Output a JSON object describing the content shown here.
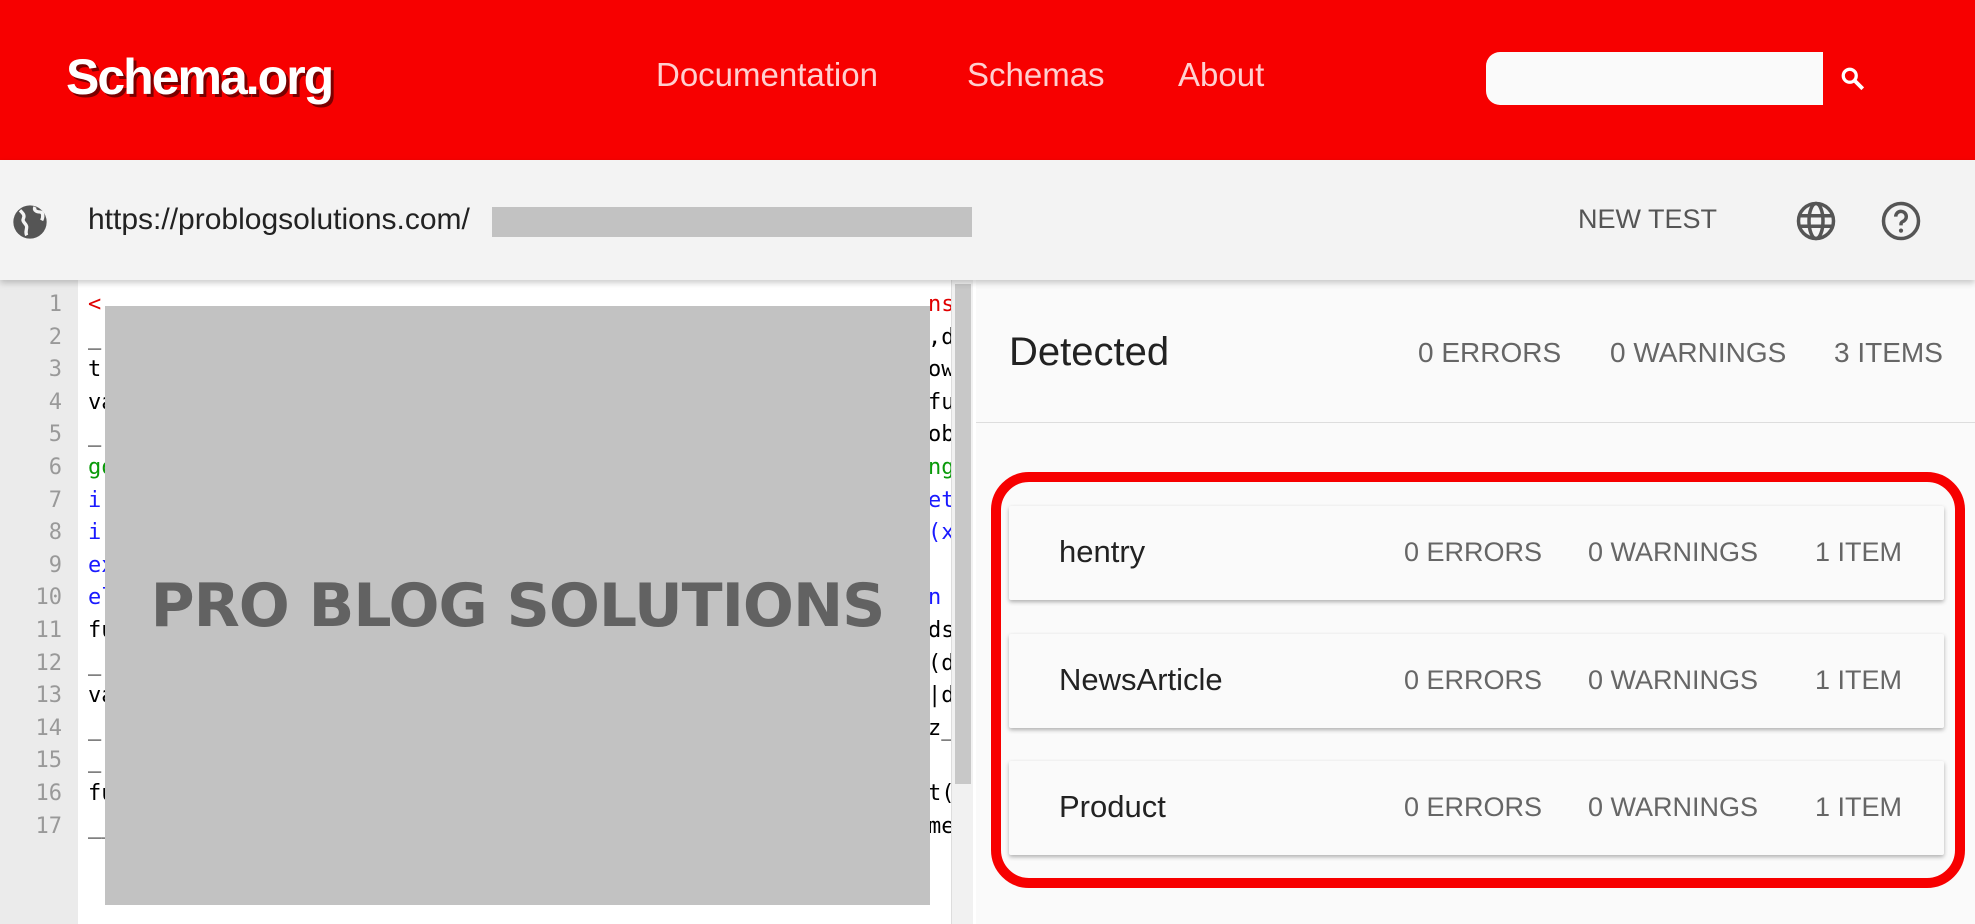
{
  "header": {
    "logo": "Schema.org",
    "nav": [
      "Documentation",
      "Schemas",
      "About"
    ],
    "search_placeholder": "",
    "search_icon": "search-icon",
    "brand_color": "#f70000"
  },
  "toolbar": {
    "url": "https://problogsolutions.com/",
    "new_test": "NEW TEST",
    "globe_icon": "globe-icon",
    "help_icon": "help-icon"
  },
  "code": {
    "lines": [
      {
        "n": "1",
        "left": "<",
        "right": "ns#",
        "color": "#e00000"
      },
      {
        "n": "2",
        "left": "_",
        "right": ",di",
        "color": "#000"
      },
      {
        "n": "3",
        "left": "tr",
        "right": "ow.",
        "color": "#000"
      },
      {
        "n": "4",
        "left": "va",
        "right": "fun",
        "color": "#000"
      },
      {
        "n": "5",
        "left": "_",
        "right": "obf",
        "color": "#000"
      },
      {
        "n": "6",
        "left": "go",
        "right": "ng.",
        "color": "#0a9a0a"
      },
      {
        "n": "7",
        "left": "i",
        "right": "etT",
        "color": "#1a1aff"
      },
      {
        "n": "8",
        "left": "i",
        "right": "(x)",
        "color": "#1a1aff"
      },
      {
        "n": "9",
        "left": "ex",
        "right": "",
        "color": "#1a1aff"
      },
      {
        "n": "10",
        "left": "el",
        "right": "n _",
        "color": "#1a1aff"
      },
      {
        "n": "11",
        "left": "fu",
        "right": "ds.",
        "color": "#000"
      },
      {
        "n": "12",
        "left": "_",
        "right": "(di",
        "color": "#000"
      },
      {
        "n": "13",
        "left": "va",
        "right": "|do",
        "color": "#000"
      },
      {
        "n": "14",
        "left": "_",
        "right": "z_f",
        "color": "#000"
      },
      {
        "n": "15",
        "left": "_",
        "right": "",
        "color": "#000"
      },
      {
        "n": "16",
        "left": "fu",
        "right": "t(f",
        "color": "#000"
      },
      {
        "n": "17",
        "left": "__",
        "right": "meo",
        "color": "#000"
      }
    ],
    "overlay_text": "PRO BLOG SOLUTIONS"
  },
  "detected": {
    "title": "Detected",
    "errors": "0 ERRORS",
    "warnings": "0 WARNINGS",
    "items": "3 ITEMS",
    "types": [
      {
        "name": "hentry",
        "errors": "0 ERRORS",
        "warnings": "0 WARNINGS",
        "items": "1 ITEM"
      },
      {
        "name": "NewsArticle",
        "errors": "0 ERRORS",
        "warnings": "0 WARNINGS",
        "items": "1 ITEM"
      },
      {
        "name": "Product",
        "errors": "0 ERRORS",
        "warnings": "0 WARNINGS",
        "items": "1 ITEM"
      }
    ]
  }
}
